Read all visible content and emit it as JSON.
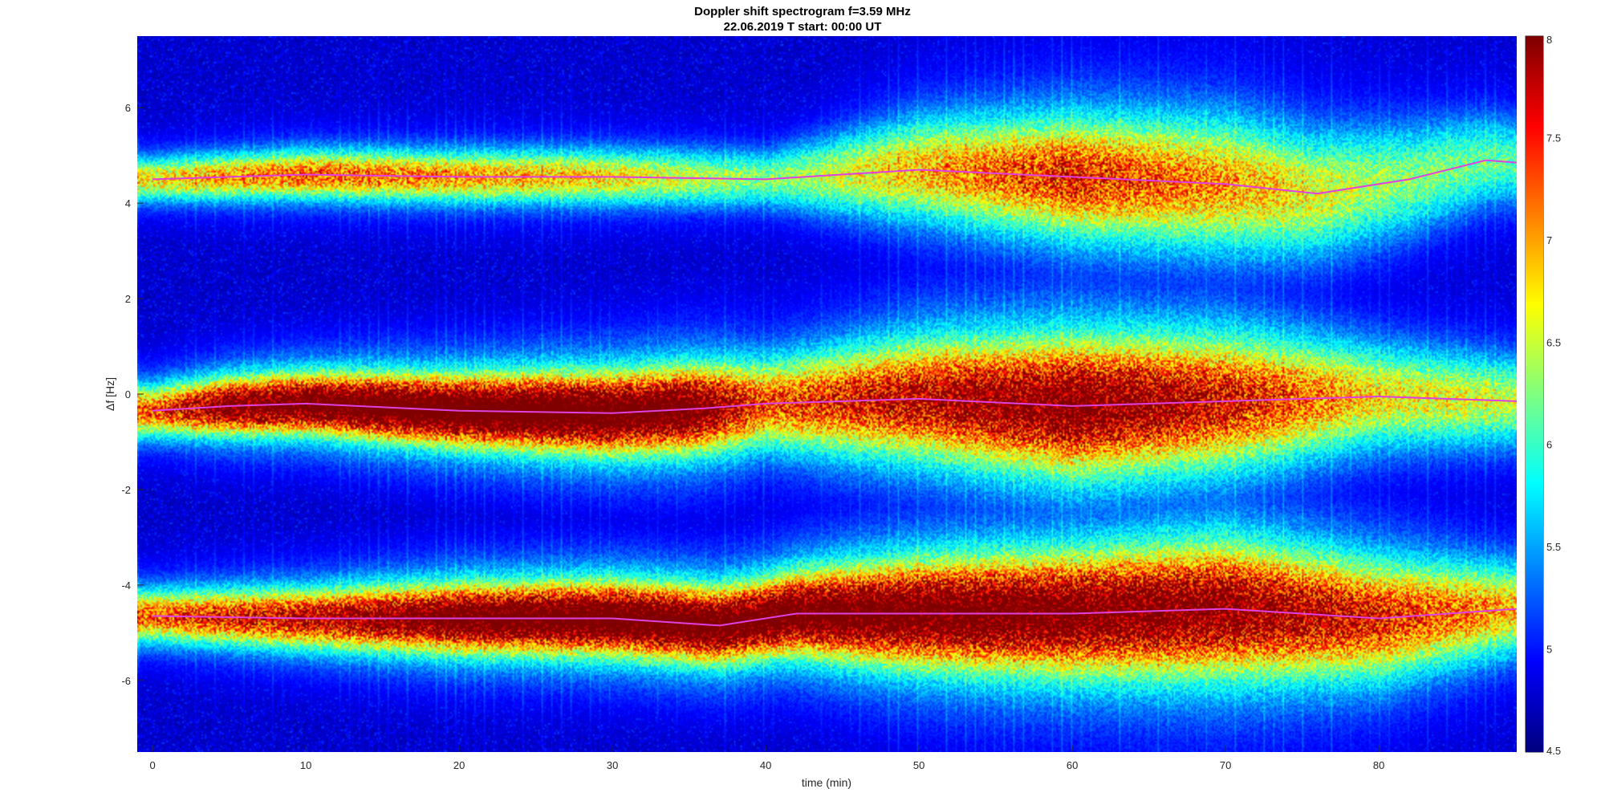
{
  "chart_data": {
    "type": "heatmap",
    "title": "Doppler shift spectrogram f=3.59 MHz",
    "subtitle": "22.06.2019    T start: 00:00 UT",
    "xlabel": "time (min)",
    "ylabel": "Δf [Hz]",
    "xlim": [
      -1,
      89
    ],
    "ylim": [
      -7.5,
      7.5
    ],
    "xticks": [
      0,
      10,
      20,
      30,
      40,
      50,
      60,
      70,
      80
    ],
    "yticks": [
      -6,
      -4,
      -2,
      0,
      2,
      4,
      6
    ],
    "colorbar": {
      "colormap": "jet",
      "clim": [
        4.5,
        8
      ],
      "ticks": [
        4.5,
        5,
        5.5,
        6,
        6.5,
        7,
        7.5,
        8
      ]
    },
    "bands": [
      {
        "label": "",
        "center_hz": [
          [
            0,
            4.5
          ],
          [
            10,
            4.6
          ],
          [
            20,
            4.55
          ],
          [
            30,
            4.55
          ],
          [
            40,
            4.5
          ],
          [
            50,
            4.7
          ],
          [
            60,
            4.55
          ],
          [
            70,
            4.4
          ],
          [
            76,
            4.2
          ],
          [
            82,
            4.5
          ],
          [
            87,
            4.9
          ],
          [
            89,
            4.85
          ]
        ],
        "intensity": [
          [
            0,
            6.2
          ],
          [
            10,
            6.6
          ],
          [
            20,
            6.4
          ],
          [
            30,
            6.2
          ],
          [
            40,
            5.8
          ],
          [
            50,
            6.3
          ],
          [
            60,
            6.8
          ],
          [
            70,
            6.4
          ],
          [
            80,
            5.9
          ],
          [
            89,
            5.7
          ]
        ],
        "width_hz": [
          [
            0,
            0.3
          ],
          [
            20,
            0.35
          ],
          [
            40,
            0.4
          ],
          [
            50,
            0.7
          ],
          [
            60,
            0.8
          ],
          [
            70,
            0.9
          ],
          [
            80,
            0.8
          ],
          [
            89,
            0.6
          ]
        ]
      },
      {
        "label": "",
        "center_hz": [
          [
            0,
            -0.35
          ],
          [
            5,
            -0.25
          ],
          [
            10,
            -0.2
          ],
          [
            20,
            -0.35
          ],
          [
            30,
            -0.4
          ],
          [
            36,
            -0.3
          ],
          [
            40,
            -0.2
          ],
          [
            50,
            -0.1
          ],
          [
            60,
            -0.25
          ],
          [
            70,
            -0.15
          ],
          [
            80,
            -0.05
          ],
          [
            89,
            -0.15
          ]
        ],
        "intensity": [
          [
            0,
            6.6
          ],
          [
            5,
            7.4
          ],
          [
            15,
            7.8
          ],
          [
            25,
            7.9
          ],
          [
            35,
            7.6
          ],
          [
            40,
            6.6
          ],
          [
            50,
            7.0
          ],
          [
            60,
            7.4
          ],
          [
            70,
            6.9
          ],
          [
            80,
            6.2
          ],
          [
            89,
            6.0
          ]
        ],
        "width_hz": [
          [
            0,
            0.35
          ],
          [
            20,
            0.45
          ],
          [
            40,
            0.6
          ],
          [
            50,
            0.8
          ],
          [
            60,
            0.9
          ],
          [
            70,
            0.9
          ],
          [
            80,
            0.7
          ],
          [
            89,
            0.6
          ]
        ]
      },
      {
        "label": "",
        "center_hz": [
          [
            0,
            -4.65
          ],
          [
            10,
            -4.7
          ],
          [
            20,
            -4.7
          ],
          [
            30,
            -4.7
          ],
          [
            37,
            -4.85
          ],
          [
            42,
            -4.6
          ],
          [
            50,
            -4.6
          ],
          [
            60,
            -4.6
          ],
          [
            70,
            -4.5
          ],
          [
            80,
            -4.7
          ],
          [
            89,
            -4.5
          ]
        ],
        "intensity": [
          [
            0,
            6.6
          ],
          [
            10,
            7.0
          ],
          [
            20,
            7.6
          ],
          [
            30,
            7.8
          ],
          [
            40,
            7.7
          ],
          [
            50,
            7.6
          ],
          [
            60,
            7.5
          ],
          [
            70,
            7.3
          ],
          [
            80,
            6.8
          ],
          [
            89,
            6.3
          ]
        ],
        "width_hz": [
          [
            0,
            0.35
          ],
          [
            20,
            0.45
          ],
          [
            40,
            0.5
          ],
          [
            50,
            0.7
          ],
          [
            60,
            0.8
          ],
          [
            70,
            0.9
          ],
          [
            80,
            0.8
          ],
          [
            89,
            0.6
          ]
        ]
      }
    ],
    "trace_lines": [
      {
        "label": "",
        "color": "#e040e0",
        "points": [
          [
            0,
            4.5
          ],
          [
            10,
            4.6
          ],
          [
            20,
            4.55
          ],
          [
            30,
            4.55
          ],
          [
            40,
            4.5
          ],
          [
            50,
            4.7
          ],
          [
            60,
            4.55
          ],
          [
            70,
            4.4
          ],
          [
            76,
            4.2
          ],
          [
            82,
            4.5
          ],
          [
            87,
            4.9
          ],
          [
            89,
            4.85
          ]
        ]
      },
      {
        "label": "",
        "color": "#e040e0",
        "points": [
          [
            0,
            -0.35
          ],
          [
            5,
            -0.25
          ],
          [
            10,
            -0.2
          ],
          [
            20,
            -0.35
          ],
          [
            30,
            -0.4
          ],
          [
            36,
            -0.3
          ],
          [
            40,
            -0.2
          ],
          [
            50,
            -0.1
          ],
          [
            60,
            -0.25
          ],
          [
            70,
            -0.15
          ],
          [
            80,
            -0.05
          ],
          [
            89,
            -0.15
          ]
        ]
      },
      {
        "label": "",
        "color": "#e040e0",
        "points": [
          [
            0,
            -4.65
          ],
          [
            10,
            -4.7
          ],
          [
            20,
            -4.7
          ],
          [
            30,
            -4.7
          ],
          [
            37,
            -4.85
          ],
          [
            42,
            -4.6
          ],
          [
            50,
            -4.6
          ],
          [
            60,
            -4.6
          ],
          [
            70,
            -4.5
          ],
          [
            80,
            -4.7
          ],
          [
            89,
            -4.5
          ]
        ]
      }
    ],
    "grid": false,
    "legend": "none"
  }
}
